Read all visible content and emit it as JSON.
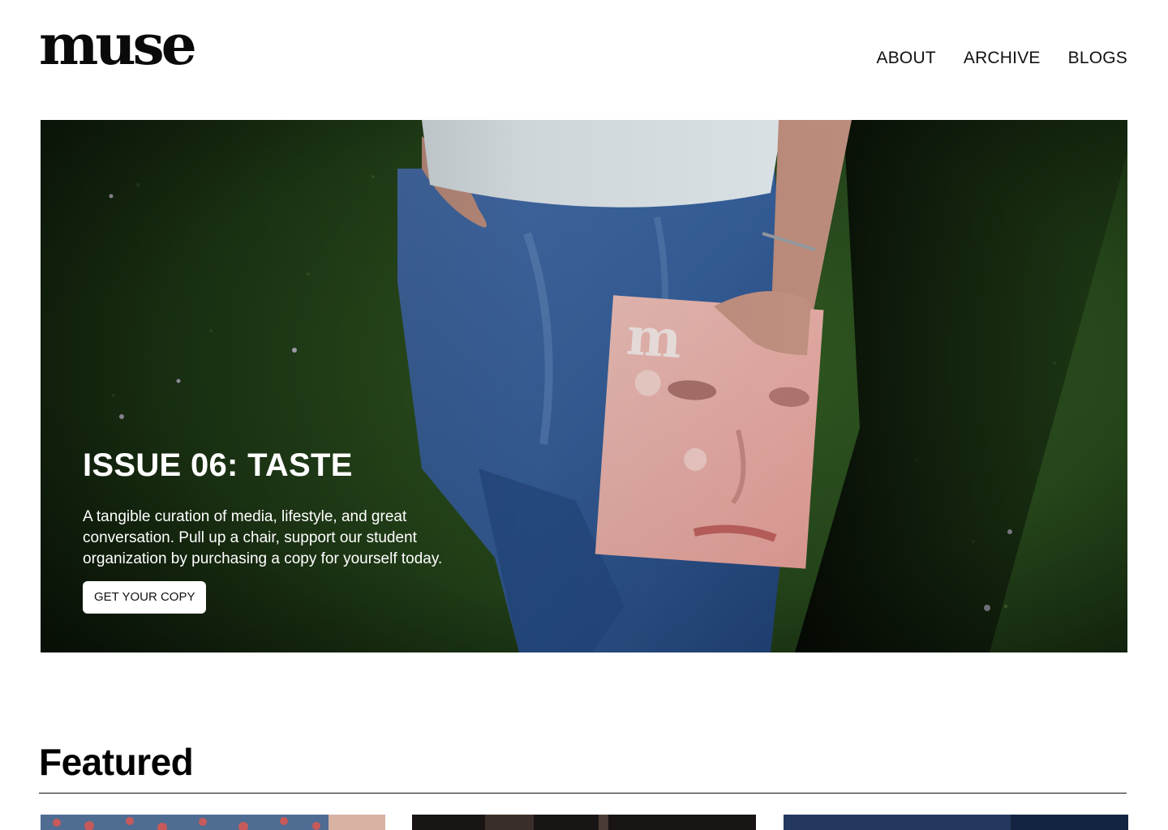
{
  "header": {
    "logo": "muse",
    "nav": [
      {
        "label": "ABOUT"
      },
      {
        "label": "ARCHIVE"
      },
      {
        "label": "BLOGS"
      }
    ]
  },
  "hero": {
    "title": "ISSUE 06: TASTE",
    "description": "A tangible curation of media, lifestyle, and great conversation. Pull up a chair, support our student organization by purchasing a copy for yourself today.",
    "cta_label": "GET YOUR COPY",
    "image_description_icon": "person-holding-magazine-photo",
    "magazine_logo": "m"
  },
  "featured": {
    "title": "Featured",
    "cards": [
      {
        "icon": "floral-photo"
      },
      {
        "icon": "dark-interior-photo"
      },
      {
        "icon": "blue-water-photo"
      }
    ]
  },
  "colors": {
    "text": "#000000",
    "background": "#ffffff",
    "hero_grass": "#264a1c",
    "jeans": "#3e67a3",
    "shirt": "#e6eef2"
  }
}
